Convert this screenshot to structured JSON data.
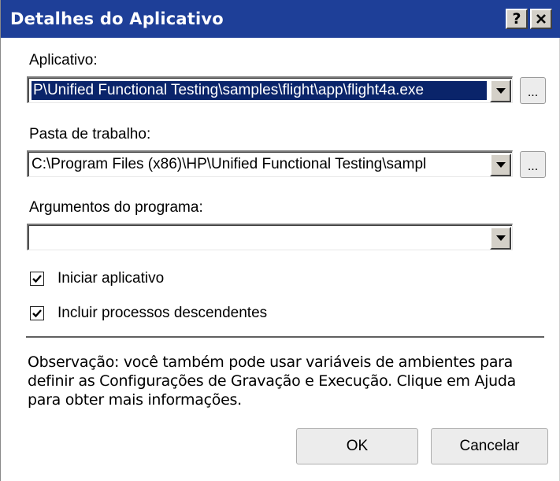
{
  "window": {
    "title": "Detalhes do Aplicativo",
    "help_label": "?",
    "close_label": "✕",
    "titlebar_color": "#1e3f98"
  },
  "application": {
    "label": "Aplicativo:",
    "value": "P\\Unified Functional Testing\\samples\\flight\\app\\flight4a.exe",
    "browse_label": "..."
  },
  "working_folder": {
    "label": "Pasta de trabalho:",
    "value": "C:\\Program Files (x86)\\HP\\Unified Functional Testing\\sampl",
    "browse_label": "..."
  },
  "arguments": {
    "label": "Argumentos do programa:",
    "value": ""
  },
  "options": {
    "launch_app": {
      "label": "Iniciar aplicativo",
      "checked": true
    },
    "include_children": {
      "label": "Incluir processos descendentes",
      "checked": true
    }
  },
  "note": "Observação: você também pode usar variáveis de ambientes para definir as Configurações de Gravação e Execução. Clique em Ajuda para obter mais informações.",
  "buttons": {
    "ok": "OK",
    "cancel": "Cancelar"
  }
}
